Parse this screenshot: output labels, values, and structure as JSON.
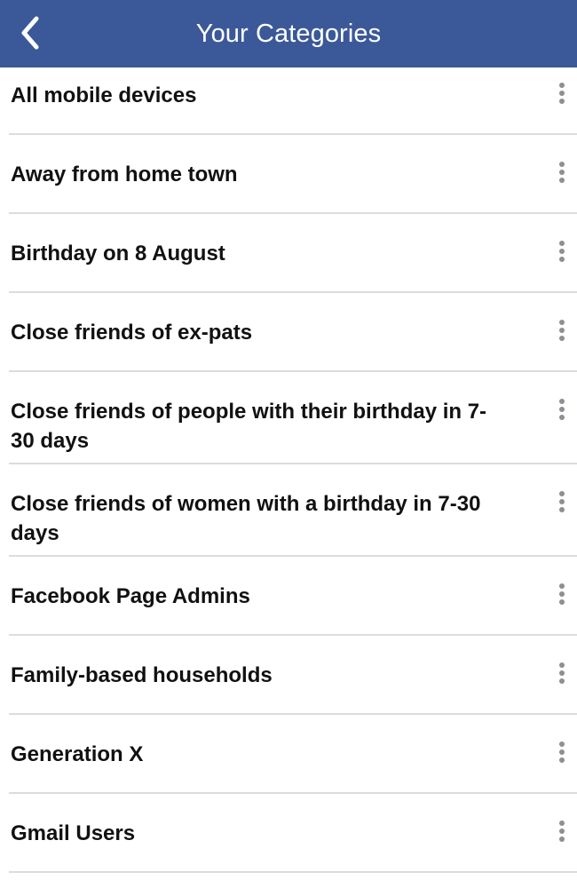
{
  "header": {
    "title": "Your Categories",
    "back_icon": "chevron-left-icon"
  },
  "colors": {
    "navbar": "#3b5998",
    "divider": "#dcdcdc",
    "text": "#111111",
    "more_icon": "#8e8e93"
  },
  "categories": [
    {
      "label": "All mobile devices"
    },
    {
      "label": "Away from home town"
    },
    {
      "label": "Birthday on 8 August"
    },
    {
      "label": "Close friends of ex-pats"
    },
    {
      "label": "Close friends of people with their birthday in 7-30 days"
    },
    {
      "label": "Close friends of women with a birthday in 7-30 days"
    },
    {
      "label": "Facebook Page Admins"
    },
    {
      "label": "Family-based households"
    },
    {
      "label": "Generation X"
    },
    {
      "label": "Gmail Users"
    }
  ],
  "row_action_icon": "more-vertical-icon"
}
